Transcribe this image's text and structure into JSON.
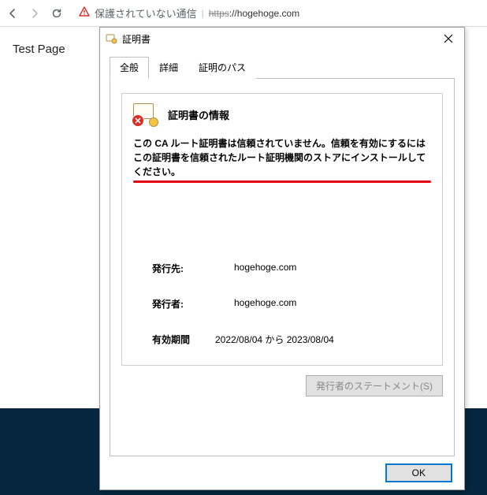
{
  "browser": {
    "not_secure_label": "保護されていない通信",
    "url_scheme_struck": "https",
    "url_rest": "://hogehoge.com"
  },
  "page": {
    "heading": "Test Page"
  },
  "dialog": {
    "title": "証明書",
    "tabs": {
      "general": "全般",
      "details": "詳細",
      "path": "証明のパス"
    },
    "info_heading": "証明書の情報",
    "warning_text": "この CA ルート証明書は信頼されていません。信頼を有効にするにはこの証明書を信頼されたルート証明機関のストアにインストールしてください。",
    "issued_to_label": "発行先:",
    "issued_to_value": "hogehoge.com",
    "issued_by_label": "発行者:",
    "issued_by_value": "hogehoge.com",
    "validity_label": "有効期間",
    "validity_text": "2022/08/04 から 2023/08/04",
    "statement_button": "発行者のステートメント(S)",
    "ok_button": "OK"
  }
}
